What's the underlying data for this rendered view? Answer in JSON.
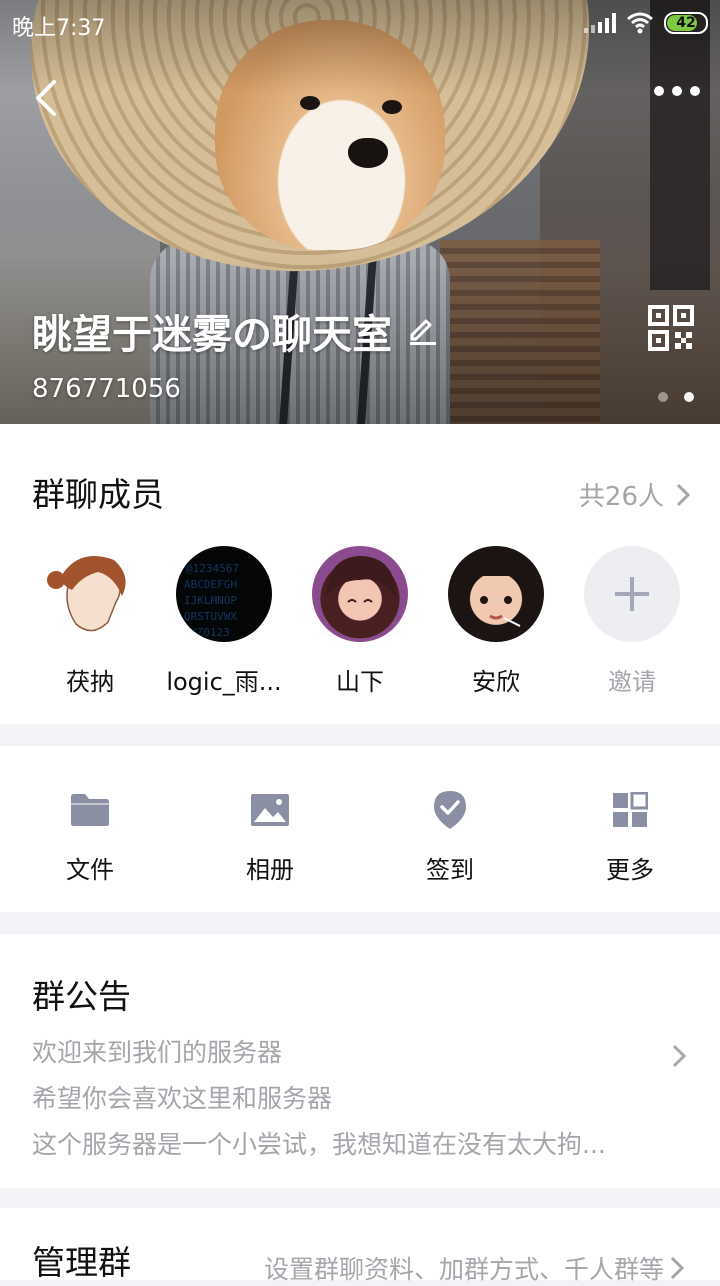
{
  "status_bar": {
    "time": "晚上7:37",
    "battery": "42"
  },
  "header": {
    "group_name": "眺望于迷雾の聊天室",
    "group_id": "876771056"
  },
  "members": {
    "title": "群聊成员",
    "count": "共26人",
    "list": [
      {
        "name": "茯抐"
      },
      {
        "name": "logic_雨..."
      },
      {
        "name": "山下"
      },
      {
        "name": "安欣"
      }
    ],
    "invite_label": "邀请"
  },
  "tools": [
    {
      "label": "文件",
      "icon": "folder-icon"
    },
    {
      "label": "相册",
      "icon": "image-icon"
    },
    {
      "label": "签到",
      "icon": "checkin-icon"
    },
    {
      "label": "更多",
      "icon": "grid-icon"
    }
  ],
  "notice": {
    "title": "群公告",
    "lines": [
      "欢迎来到我们的服务器",
      "希望你会喜欢这里和服务器",
      "这个服务器是一个小尝试，我想知道在没有太大拘..."
    ]
  },
  "manage": {
    "title": "管理群",
    "subtitle": "设置群聊资料、加群方式、千人群等"
  },
  "colors": {
    "accent_gray": "#8a8fa3",
    "muted_text": "#a4a6ab"
  }
}
